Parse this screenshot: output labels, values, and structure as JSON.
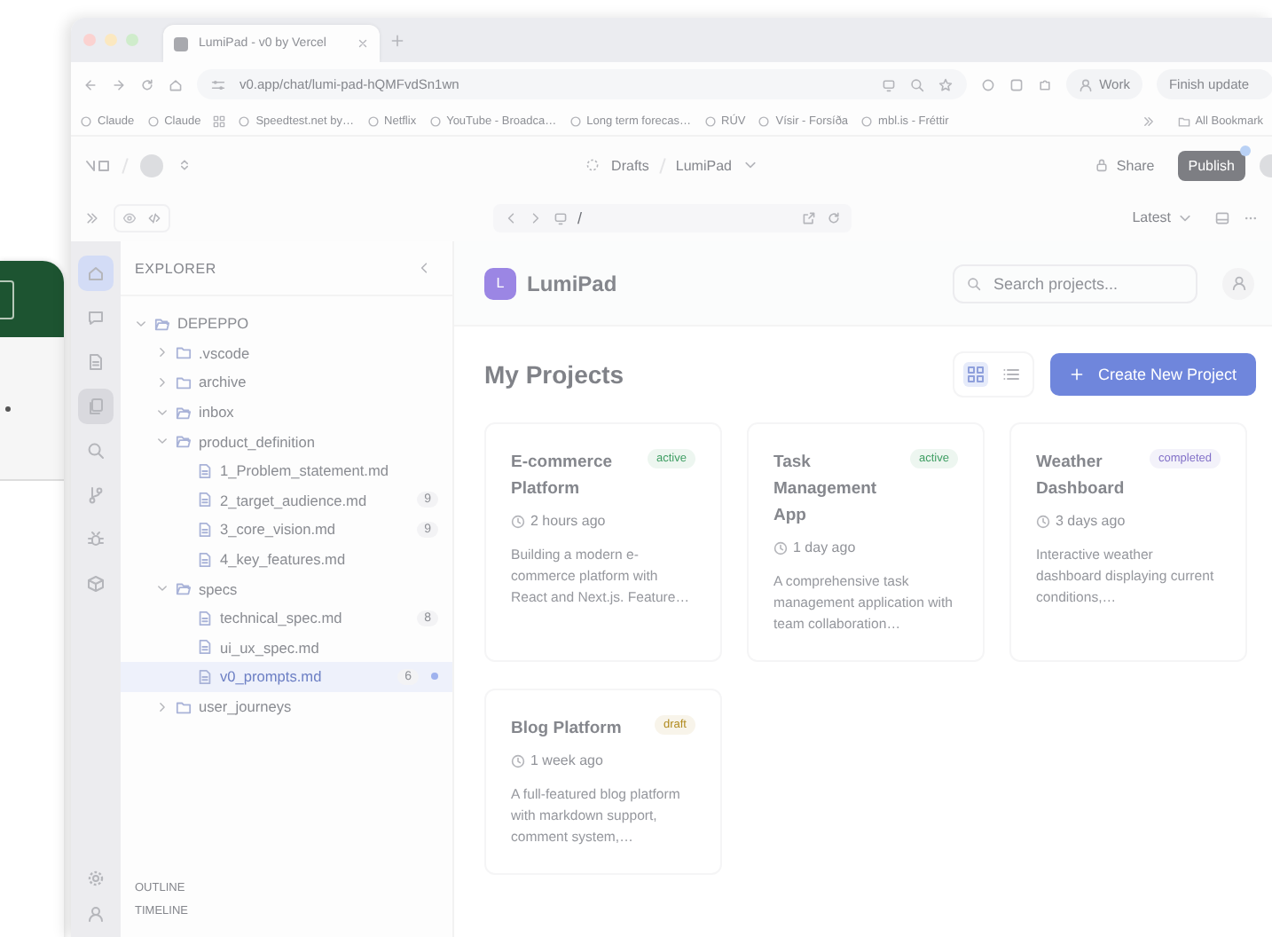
{
  "browser": {
    "tabs": [
      {
        "title": "LumiPad - v0 by Vercel",
        "selected": true
      }
    ],
    "url": "v0.app/chat/lumi-pad-hQMFvdSn1wn",
    "profile": "Work",
    "update_button": "Finish update",
    "bookmarks": [
      {
        "label": "Claude"
      },
      {
        "label": "Claude"
      },
      {
        "label": "Speedtest.net by…"
      },
      {
        "label": "Netflix"
      },
      {
        "label": "YouTube - Broadca…"
      },
      {
        "label": "Long term forecas…"
      },
      {
        "label": "RÚV"
      },
      {
        "label": "Vísir - Forsíða"
      },
      {
        "label": "mbl.is - Fréttir"
      }
    ],
    "all_bookmarks": "All Bookmark"
  },
  "v0_header": {
    "breadcrumb": [
      "Drafts",
      "LumiPad"
    ],
    "share": "Share",
    "publish": "Publish"
  },
  "preview_bar": {
    "path": "/",
    "version": "Latest",
    "view_modes": [
      {
        "selected": true
      },
      {
        "selected": false
      }
    ]
  },
  "rail": [
    {
      "selected": true
    },
    {
      "selected": false
    },
    {
      "selected": false
    },
    {
      "selected": true
    },
    {
      "selected": false
    },
    {
      "selected": false
    },
    {
      "selected": false
    },
    {
      "selected": false
    }
  ],
  "explorer": {
    "title": "EXPLORER",
    "tree": [
      {
        "kind": "folder",
        "name": "DEPEPPO",
        "expanded": true,
        "children": [
          {
            "kind": "folder",
            "name": ".vscode",
            "expanded": false
          },
          {
            "kind": "folder",
            "name": "archive",
            "expanded": false
          },
          {
            "kind": "folder",
            "name": "inbox",
            "expanded": true
          },
          {
            "kind": "folder",
            "name": "product_definition",
            "expanded": true,
            "children": [
              {
                "kind": "file",
                "name": "1_Problem_statement.md",
                "selected": false
              },
              {
                "kind": "file",
                "name": "2_target_audience.md",
                "badge": "9",
                "selected": false
              },
              {
                "kind": "file",
                "name": "3_core_vision.md",
                "badge": "9",
                "selected": false
              },
              {
                "kind": "file",
                "name": "4_key_features.md",
                "selected": false
              }
            ]
          },
          {
            "kind": "folder",
            "name": "specs",
            "expanded": true,
            "children": [
              {
                "kind": "file",
                "name": "technical_spec.md",
                "badge": "8",
                "selected": false
              },
              {
                "kind": "file",
                "name": "ui_ux_spec.md",
                "selected": false
              },
              {
                "kind": "file",
                "name": "v0_prompts.md",
                "badge": "6",
                "modified": true,
                "selected": true
              }
            ]
          },
          {
            "kind": "folder",
            "name": "user_journeys",
            "expanded": false
          }
        ]
      }
    ],
    "sections": [
      "OUTLINE",
      "TIMELINE"
    ]
  },
  "app": {
    "logo": "L",
    "name": "LumiPad",
    "search_placeholder": "Search projects...",
    "heading": "My Projects",
    "layout_toggle": [
      {
        "selected": true
      },
      {
        "selected": false
      }
    ],
    "create_button": "Create New Project",
    "projects": [
      {
        "title": "E-commerce Platform",
        "status": "active",
        "color": "#3f9e63",
        "time": "2 hours ago",
        "description": "Building a modern e-commerce platform with React and Next.js. Feature…"
      },
      {
        "title": "Task Management App",
        "status": "active",
        "color": "#3f9e63",
        "time": "1 day ago",
        "description": "A comprehensive task management application with team collaboration…"
      },
      {
        "title": "Weather Dashboard",
        "status": "completed",
        "color": "#8270c8",
        "time": "3 days ago",
        "description": "Interactive weather dashboard displaying current conditions,…"
      },
      {
        "title": "Blog Platform",
        "status": "draft",
        "color": "#b08a1e",
        "time": "1 week ago",
        "description": "A full-featured blog platform with markdown support, comment system,…"
      }
    ]
  }
}
